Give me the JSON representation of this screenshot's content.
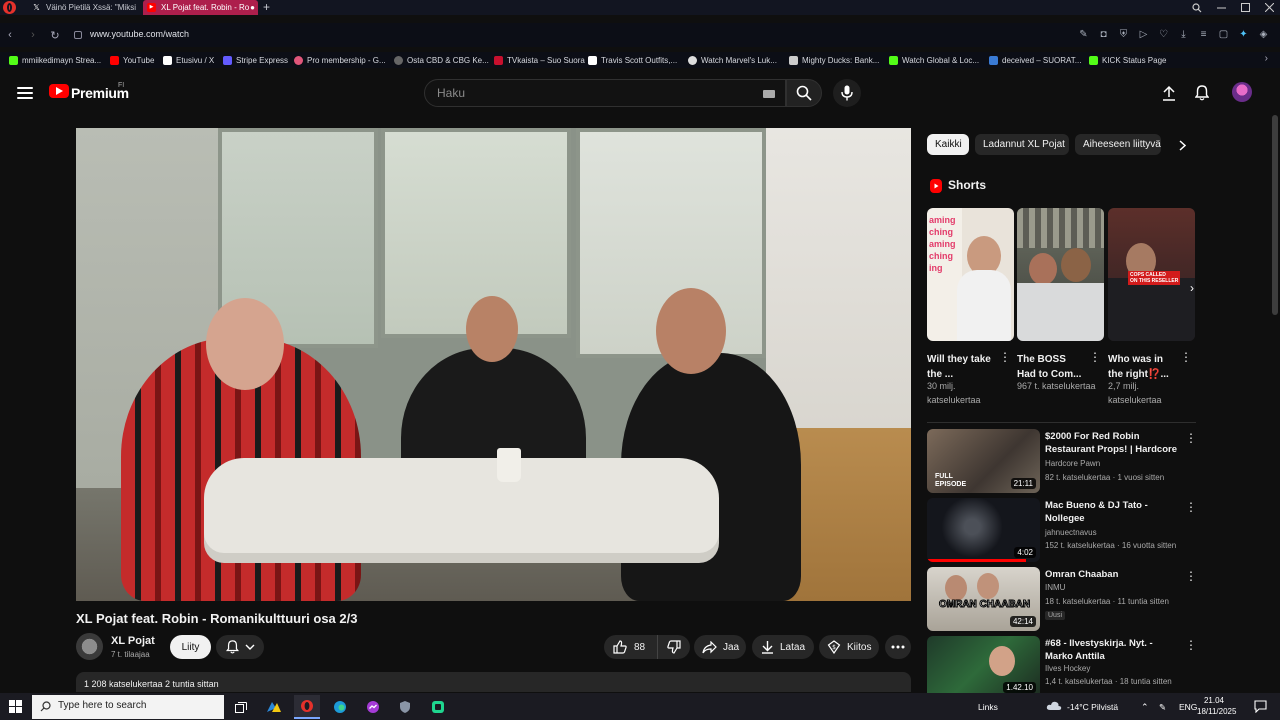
{
  "browser": {
    "tabs": [
      {
        "label": "Väinö Pietilä Xssä: \"Miksi",
        "icon": "x-logo-icon"
      },
      {
        "label": "XL Pojat feat. Robin - Ro",
        "icon": "youtube-icon",
        "active": true
      }
    ],
    "url": "www.youtube.com/watch",
    "bookmarks": [
      {
        "label": "mmiikedimayn Strea...",
        "color": "#53fc18"
      },
      {
        "label": "YouTube",
        "color": "#ff0000"
      },
      {
        "label": "Etusivu / X",
        "color": "#ffffff"
      },
      {
        "label": "Stripe Express",
        "color": "#635bff"
      },
      {
        "label": "Pro membership - G...",
        "color": "#e0567a"
      },
      {
        "label": "Osta CBD & CBG Ke...",
        "color": "#888888"
      },
      {
        "label": "TVkaista – Suo Suora",
        "color": "#c8102e"
      },
      {
        "label": "Travis Scott Outfits,...",
        "color": "#ffffff"
      },
      {
        "label": "Watch Marvel's Luk...",
        "color": "#dddddd"
      },
      {
        "label": "Mighty Ducks: Bank...",
        "color": "#cccccc"
      },
      {
        "label": "Watch Global & Loc...",
        "color": "#53fc18"
      },
      {
        "label": "deceived – SUORAT...",
        "color": "#3a7bd5"
      },
      {
        "label": "KICK Status Page",
        "color": "#53fc18"
      }
    ]
  },
  "header": {
    "brand": "Premium",
    "country": "FI",
    "search_placeholder": "Haku"
  },
  "video": {
    "title": "XL Pojat feat. Robin - Romanikulttuuri osa 2/3",
    "channel": "XL Pojat",
    "subscribers": "7 t. tilaajaa",
    "join_label": "Liity",
    "likes": "88",
    "share_label": "Jaa",
    "download_label": "Lataa",
    "thanks_label": "Kiitos",
    "views_time": "1 208 katselukertaa  2 tuntia sittan"
  },
  "chips": [
    "Kaikki",
    "Ladannut XL Pojat",
    "Aiheeseen liittyvät"
  ],
  "shorts": {
    "heading": "Shorts",
    "items": [
      {
        "title": "Will they take the ...",
        "views": "30 milj. katselukertaa"
      },
      {
        "title": "The BOSS Had to Com...",
        "views": "967 t. katselukertaa"
      },
      {
        "title": "Who was in the right⁉️...",
        "views": "2,7 milj. katselukertaa"
      }
    ],
    "thumb_texts": {
      "short1": [
        "aming",
        "ching",
        "aming",
        "ching",
        "ing"
      ],
      "short3": [
        "COPS CALLED",
        "ON THIS RESELLER"
      ]
    }
  },
  "recommendations": [
    {
      "title": "$2000 For Red Robin Restaurant Props! | Hardcore ...",
      "channel": "Hardcore Pawn",
      "stats": "82 t. katselukertaa · 1 vuosi sitten",
      "duration": "21:11",
      "thumb_text": "FULL EPISODE"
    },
    {
      "title": "Mac Bueno & DJ Tato - Nollegee",
      "channel": "jahnuectnavus",
      "stats": "152 t. katselukertaa · 16 vuotta sitten",
      "duration": "4:02",
      "progress": 0.88
    },
    {
      "title": "Omran Chaaban",
      "channel": "INMU",
      "stats": "18 t. katselukertaa · 11 tuntia sitten",
      "duration": "42:14",
      "badge": "Uusi",
      "thumb_text": "OMRAN CHAABAN"
    },
    {
      "title": "#68 - Ilvestyskirja. Nyt. - Marko Anttila",
      "channel": "Ilves Hockey",
      "stats": "1,4 t. katselukertaa · 18 tuntia sitten",
      "duration": "1.42.10"
    }
  ],
  "taskbar": {
    "search_placeholder": "Type here to search",
    "links": "Links",
    "weather": "-14°C  Pilvistä",
    "lang": "ENG",
    "time": "21.04",
    "date": "18/11/2025"
  }
}
